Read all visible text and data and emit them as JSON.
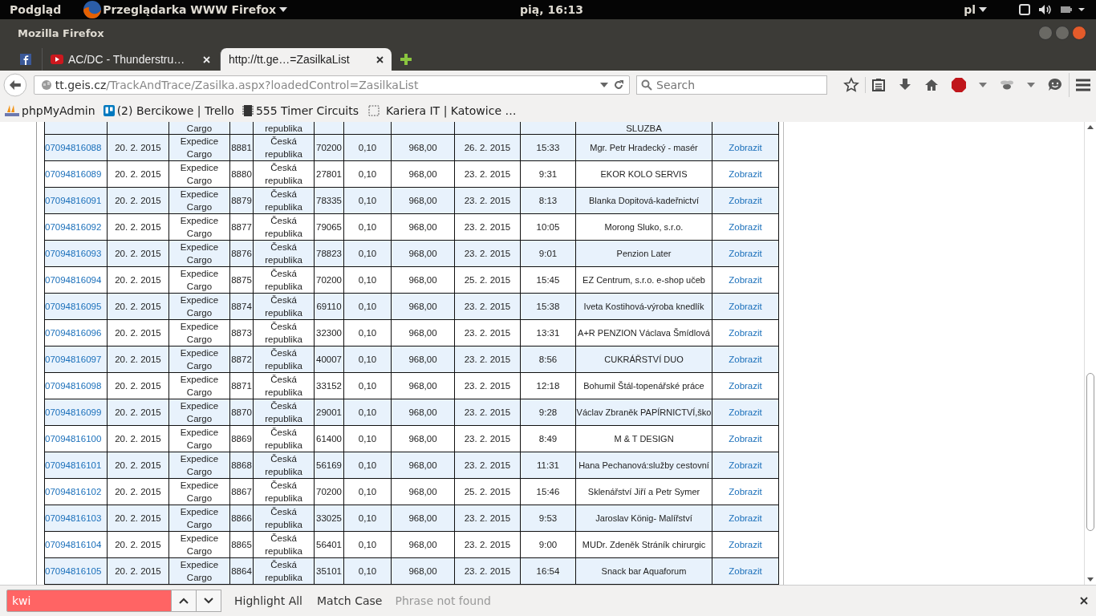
{
  "top_panel": {
    "app_menu": "Podgląd",
    "app_name": "Przeglądarka WWW Firefox",
    "clock": "pią, 16:13",
    "keyboard": "pl"
  },
  "window": {
    "title": "Mozilla Firefox"
  },
  "tabs": [
    {
      "kind": "pinned",
      "selected": false
    },
    {
      "kind": "page",
      "label": "AC/DC - Thunderstru…",
      "selected": false
    },
    {
      "kind": "page",
      "label": "http://tt.ge…=ZasilkaList",
      "selected": true
    }
  ],
  "address_bar": {
    "host": "tt.geis.cz",
    "path": "/TrackAndTrace/Zasilka.aspx?loadedControl=ZasilkaList"
  },
  "search": {
    "placeholder": "Search"
  },
  "bookmarks": [
    {
      "label": "phpMyAdmin"
    },
    {
      "label": "(2) Bercikowe | Trello"
    },
    {
      "label": "555 Timer Circuits"
    },
    {
      "label": "Kariera IT | Katowice …"
    }
  ],
  "table": {
    "partial_row": {
      "column_3": "Cargo",
      "column_5": "republika",
      "column_11": "SLUZBA"
    },
    "rows": [
      [
        "07094816088",
        "20. 2. 2015",
        "Expedice Cargo",
        "8881",
        "Česká republika",
        "70200",
        "0,10",
        "968,00",
        "26. 2. 2015",
        "15:33",
        "Mgr. Petr Hradecký - masér",
        "Zobrazit"
      ],
      [
        "07094816089",
        "20. 2. 2015",
        "Expedice Cargo",
        "8880",
        "Česká republika",
        "27801",
        "0,10",
        "968,00",
        "23. 2. 2015",
        "9:31",
        "EKOR KOLO SERVIS",
        "Zobrazit"
      ],
      [
        "07094816091",
        "20. 2. 2015",
        "Expedice Cargo",
        "8879",
        "Česká republika",
        "78335",
        "0,10",
        "968,00",
        "23. 2. 2015",
        "8:13",
        "Blanka Dopitová-kadeřnictví",
        "Zobrazit"
      ],
      [
        "07094816092",
        "20. 2. 2015",
        "Expedice Cargo",
        "8877",
        "Česká republika",
        "79065",
        "0,10",
        "968,00",
        "23. 2. 2015",
        "10:05",
        "Morong Sluko, s.r.o.",
        "Zobrazit"
      ],
      [
        "07094816093",
        "20. 2. 2015",
        "Expedice Cargo",
        "8876",
        "Česká republika",
        "78823",
        "0,10",
        "968,00",
        "23. 2. 2015",
        "9:01",
        "Penzion Later",
        "Zobrazit"
      ],
      [
        "07094816094",
        "20. 2. 2015",
        "Expedice Cargo",
        "8875",
        "Česká republika",
        "70200",
        "0,10",
        "968,00",
        "25. 2. 2015",
        "15:45",
        "EZ Centrum, s.r.o. e-shop učeb",
        "Zobrazit"
      ],
      [
        "07094816095",
        "20. 2. 2015",
        "Expedice Cargo",
        "8874",
        "Česká republika",
        "69110",
        "0,10",
        "968,00",
        "23. 2. 2015",
        "15:38",
        "Iveta Kostihová-výroba knedlík",
        "Zobrazit"
      ],
      [
        "07094816096",
        "20. 2. 2015",
        "Expedice Cargo",
        "8873",
        "Česká republika",
        "32300",
        "0,10",
        "968,00",
        "23. 2. 2015",
        "13:31",
        "A+R PENZION Václava Šmídlová",
        "Zobrazit"
      ],
      [
        "07094816097",
        "20. 2. 2015",
        "Expedice Cargo",
        "8872",
        "Česká republika",
        "40007",
        "0,10",
        "968,00",
        "23. 2. 2015",
        "8:56",
        "CUKRÁŘSTVÍ DUO",
        "Zobrazit"
      ],
      [
        "07094816098",
        "20. 2. 2015",
        "Expedice Cargo",
        "8871",
        "Česká republika",
        "33152",
        "0,10",
        "968,00",
        "23. 2. 2015",
        "12:18",
        "Bohumil Štál-topenářské práce",
        "Zobrazit"
      ],
      [
        "07094816099",
        "20. 2. 2015",
        "Expedice Cargo",
        "8870",
        "Česká republika",
        "29001",
        "0,10",
        "968,00",
        "23. 2. 2015",
        "9:28",
        "Václav Zbraněk PAPÍRNICTVÍ,ško",
        "Zobrazit"
      ],
      [
        "07094816100",
        "20. 2. 2015",
        "Expedice Cargo",
        "8869",
        "Česká republika",
        "61400",
        "0,10",
        "968,00",
        "23. 2. 2015",
        "8:49",
        "M & T DESIGN",
        "Zobrazit"
      ],
      [
        "07094816101",
        "20. 2. 2015",
        "Expedice Cargo",
        "8868",
        "Česká republika",
        "56169",
        "0,10",
        "968,00",
        "23. 2. 2015",
        "11:31",
        "Hana Pechanová:služby cestovní",
        "Zobrazit"
      ],
      [
        "07094816102",
        "20. 2. 2015",
        "Expedice Cargo",
        "8867",
        "Česká republika",
        "70200",
        "0,10",
        "968,00",
        "25. 2. 2015",
        "15:46",
        "Sklenářství Jiří a Petr Symer",
        "Zobrazit"
      ],
      [
        "07094816103",
        "20. 2. 2015",
        "Expedice Cargo",
        "8866",
        "Česká republika",
        "33025",
        "0,10",
        "968,00",
        "23. 2. 2015",
        "9:53",
        "Jaroslav König- Malířství",
        "Zobrazit"
      ],
      [
        "07094816104",
        "20. 2. 2015",
        "Expedice Cargo",
        "8865",
        "Česká republika",
        "56401",
        "0,10",
        "968,00",
        "23. 2. 2015",
        "9:00",
        "MUDr. Zdeněk Stráník chirurgic",
        "Zobrazit"
      ],
      [
        "07094816105",
        "20. 2. 2015",
        "Expedice Cargo",
        "8864",
        "Česká republika",
        "35101",
        "0,10",
        "968,00",
        "23. 2. 2015",
        "16:54",
        "Snack bar Aquaforum",
        "Zobrazit"
      ]
    ]
  },
  "find_bar": {
    "value": "kwi",
    "not_found": true,
    "highlight_all": "Highlight All",
    "match_case": "Match Case",
    "status": "Phrase not found"
  }
}
